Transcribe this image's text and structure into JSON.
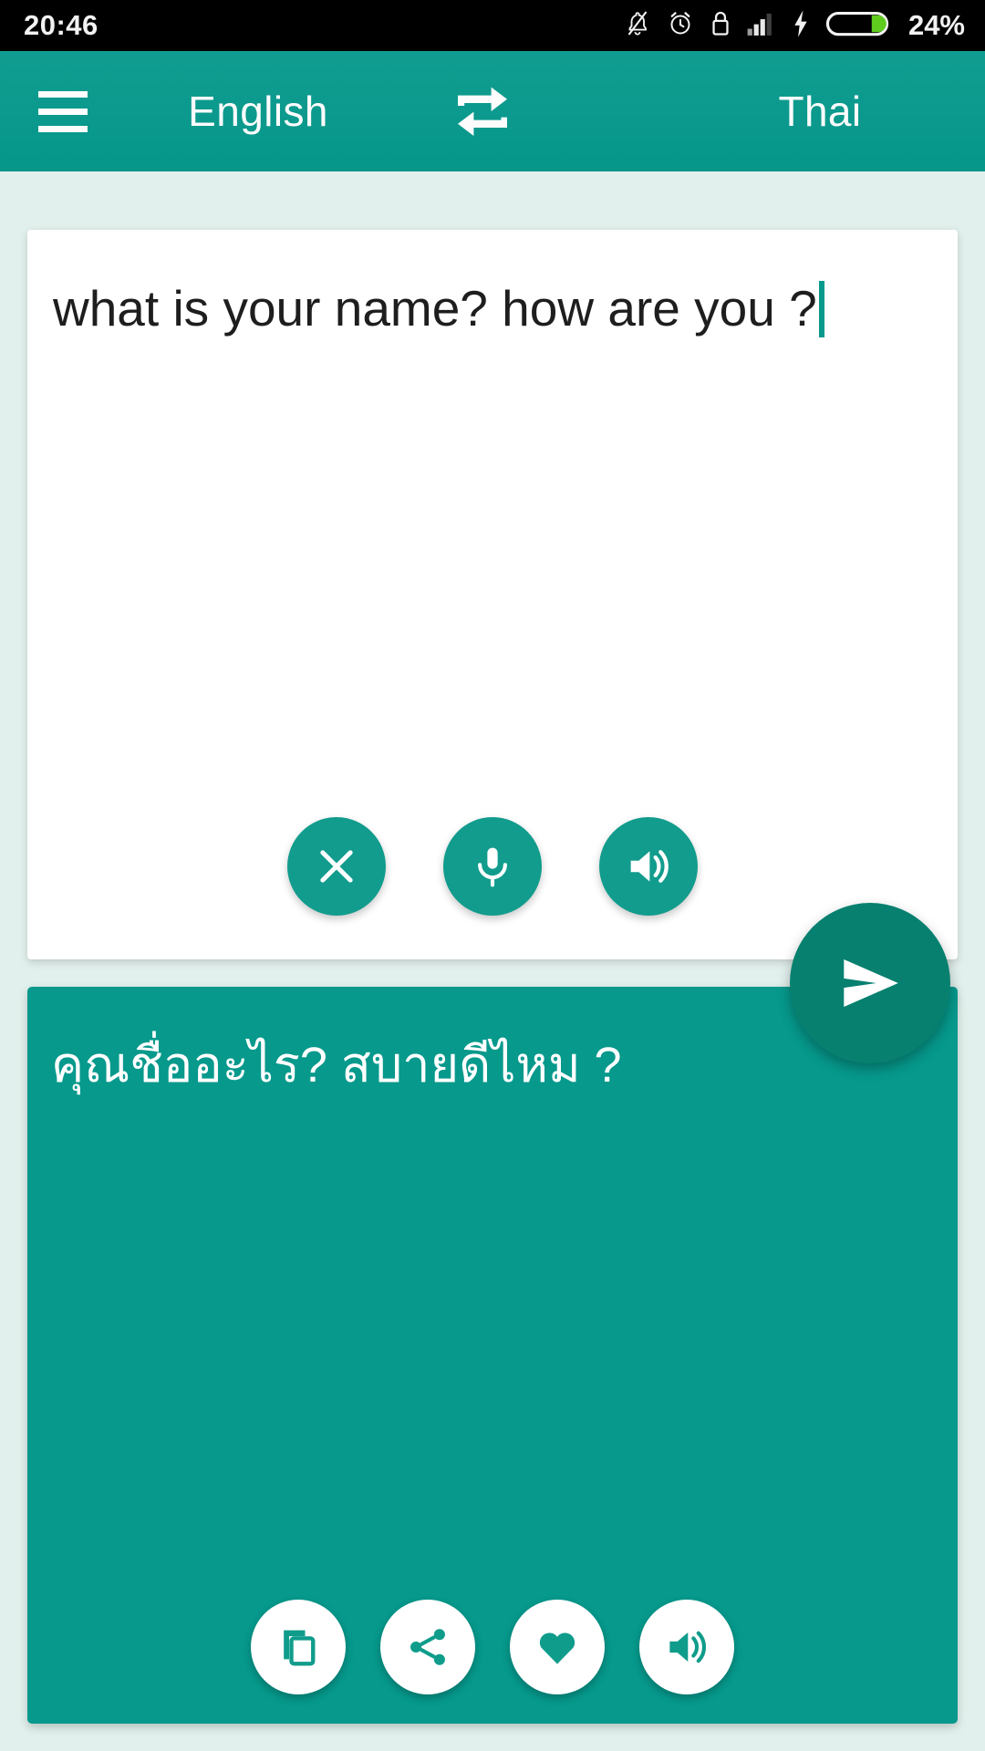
{
  "statusbar": {
    "time": "20:46",
    "battery_percent": "24%",
    "icons": [
      "bell-muted-icon",
      "alarm-clock-icon",
      "lock-icon",
      "signal-bars-icon",
      "charging-bolt-icon",
      "battery-icon"
    ],
    "battery_fill_color": "#5ecb1e",
    "background": "#000000",
    "text_color": "#f2f2f2"
  },
  "toolbar": {
    "menu_icon": "hamburger-menu-icon",
    "source_language": "English",
    "swap_icon": "swap-languages-icon",
    "target_language": "Thai",
    "background": "#06998c"
  },
  "input_card": {
    "text": "what is your name? how are you ?",
    "caret_visible": true,
    "background": "#ffffff",
    "text_color": "#1e1e1e",
    "actions": [
      {
        "name": "clear-button",
        "icon": "close-x-icon",
        "label": "Clear"
      },
      {
        "name": "voice-input-button",
        "icon": "microphone-icon",
        "label": "Speak"
      },
      {
        "name": "listen-source-button",
        "icon": "speaker-volume-icon",
        "label": "Listen"
      }
    ],
    "button_color": "#119c8d"
  },
  "send_button": {
    "name": "translate-send-button",
    "icon": "send-arrow-icon",
    "label": "Translate",
    "color": "#07806f"
  },
  "output_card": {
    "text": "คุณชื่ออะไร? สบายดีไหม ?",
    "background": "#06998c",
    "text_color": "#ffffff",
    "actions": [
      {
        "name": "copy-button",
        "icon": "copy-icon",
        "label": "Copy"
      },
      {
        "name": "share-button",
        "icon": "share-icon",
        "label": "Share"
      },
      {
        "name": "favorite-button",
        "icon": "heart-icon",
        "label": "Favorite"
      },
      {
        "name": "listen-target-button",
        "icon": "speaker-volume-icon",
        "label": "Listen"
      }
    ],
    "button_bg": "#ffffff",
    "button_icon_color": "#0f9c8b"
  },
  "page": {
    "background": "#e2f0ed"
  }
}
